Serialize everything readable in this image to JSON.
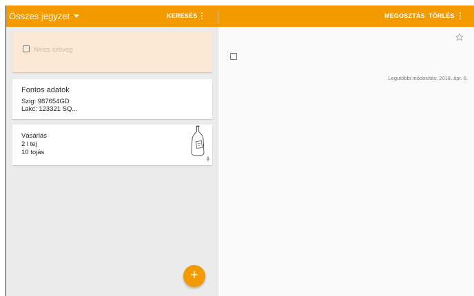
{
  "appbar": {
    "title": "Összes jegyzet",
    "search_label": "KERESÉS",
    "share_label": "MEGOSZTÁS",
    "delete_label": "TÖRLÉS"
  },
  "notes": [
    {
      "placeholder": "Nincs szöveg"
    },
    {
      "title": "Fontos adatok",
      "lines": [
        "Szig: 987654GD",
        "Lakc: 123321 SQ..."
      ]
    },
    {
      "title": "Vásárlás",
      "lines": [
        "2 l tej",
        "10 tojás"
      ],
      "thumbnail": "bottle-sketch",
      "attachment_icon": "mic-icon"
    }
  ],
  "fab": {
    "label": "+"
  },
  "editor": {
    "modified": "Legutóbbi módosítás: 2018. ápr. 6."
  },
  "colors": {
    "accent": "#f29a00",
    "selected_card": "#fbe9d6",
    "list_background": "#ebebeb"
  }
}
